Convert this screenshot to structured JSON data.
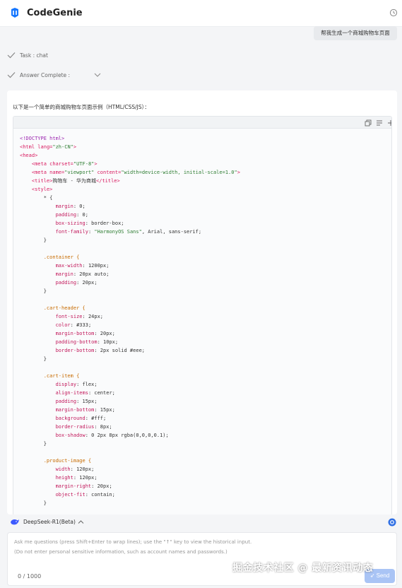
{
  "header": {
    "app_title": "CodeGenie",
    "logo_icon": "codegenie-logo-icon",
    "history_icon": "history-clock-icon"
  },
  "user_message": "帮我生成一个商城购物车页面",
  "steps": [
    {
      "label": "Task :  chat"
    },
    {
      "label": "Answer Complete :"
    }
  ],
  "answer": {
    "intro": "以下是一个简单的商城购物车页面示例（HTML/CSS/JS）：",
    "code_toolbar": {
      "copy_icon": "copy-icon",
      "insert_icon": "insert-lines-icon",
      "add_icon": "plus-icon"
    },
    "code_lines": [
      [
        {
          "t": "<!DOCTYPE html>",
          "c": "#9c27b0"
        }
      ],
      [
        {
          "t": "<html ",
          "c": "#d81b60"
        },
        {
          "t": "lang=",
          "c": "#d81b60"
        },
        {
          "t": "\"zh-CN\"",
          "c": "#2e7d32"
        },
        {
          "t": ">",
          "c": "#d81b60"
        }
      ],
      [
        {
          "t": "<head>",
          "c": "#d81b60"
        }
      ],
      [
        {
          "t": "    <meta ",
          "c": "#d81b60"
        },
        {
          "t": "charset=",
          "c": "#d81b60"
        },
        {
          "t": "\"UTF-8\"",
          "c": "#2e7d32"
        },
        {
          "t": ">",
          "c": "#d81b60"
        }
      ],
      [
        {
          "t": "    <meta ",
          "c": "#d81b60"
        },
        {
          "t": "name=",
          "c": "#d81b60"
        },
        {
          "t": "\"viewport\" ",
          "c": "#2e7d32"
        },
        {
          "t": "content=",
          "c": "#d81b60"
        },
        {
          "t": "\"width=device-width, initial-scale=1.0\"",
          "c": "#2e7d32"
        },
        {
          "t": ">",
          "c": "#d81b60"
        }
      ],
      [
        {
          "t": "    <title>",
          "c": "#d81b60"
        },
        {
          "t": "购物车 - 华为商城",
          "c": "#333333"
        },
        {
          "t": "</title>",
          "c": "#d81b60"
        }
      ],
      [
        {
          "t": "    <style>",
          "c": "#d81b60"
        }
      ],
      [
        {
          "t": "        * {",
          "c": "#333333"
        }
      ],
      [
        {
          "t": "            margin",
          "c": "#c2185b"
        },
        {
          "t": ": 0;",
          "c": "#333333"
        }
      ],
      [
        {
          "t": "            padding",
          "c": "#c2185b"
        },
        {
          "t": ": 0;",
          "c": "#333333"
        }
      ],
      [
        {
          "t": "            box-sizing",
          "c": "#c2185b"
        },
        {
          "t": ": border-box;",
          "c": "#333333"
        }
      ],
      [
        {
          "t": "            font-family",
          "c": "#c2185b"
        },
        {
          "t": ": ",
          "c": "#333333"
        },
        {
          "t": "\"HarmonyOS Sans\"",
          "c": "#2e7d32"
        },
        {
          "t": ", Arial, sans-serif;",
          "c": "#333333"
        }
      ],
      [
        {
          "t": "        }",
          "c": "#333333"
        }
      ],
      [
        {
          "t": "",
          "c": "#333333"
        }
      ],
      [
        {
          "t": "        .container {",
          "c": "#c76b00"
        }
      ],
      [
        {
          "t": "            max-width",
          "c": "#c2185b"
        },
        {
          "t": ": 1200px;",
          "c": "#333333"
        }
      ],
      [
        {
          "t": "            margin",
          "c": "#c2185b"
        },
        {
          "t": ": 20px auto;",
          "c": "#333333"
        }
      ],
      [
        {
          "t": "            padding",
          "c": "#c2185b"
        },
        {
          "t": ": 20px;",
          "c": "#333333"
        }
      ],
      [
        {
          "t": "        }",
          "c": "#333333"
        }
      ],
      [
        {
          "t": "",
          "c": "#333333"
        }
      ],
      [
        {
          "t": "        .cart-header {",
          "c": "#c76b00"
        }
      ],
      [
        {
          "t": "            font-size",
          "c": "#c2185b"
        },
        {
          "t": ": 24px;",
          "c": "#333333"
        }
      ],
      [
        {
          "t": "            color",
          "c": "#c2185b"
        },
        {
          "t": ": #333;",
          "c": "#333333"
        }
      ],
      [
        {
          "t": "            margin-bottom",
          "c": "#c2185b"
        },
        {
          "t": ": 20px;",
          "c": "#333333"
        }
      ],
      [
        {
          "t": "            padding-bottom",
          "c": "#c2185b"
        },
        {
          "t": ": 10px;",
          "c": "#333333"
        }
      ],
      [
        {
          "t": "            border-bottom",
          "c": "#c2185b"
        },
        {
          "t": ": 2px solid #eee;",
          "c": "#333333"
        }
      ],
      [
        {
          "t": "        }",
          "c": "#333333"
        }
      ],
      [
        {
          "t": "",
          "c": "#333333"
        }
      ],
      [
        {
          "t": "        .cart-item {",
          "c": "#c76b00"
        }
      ],
      [
        {
          "t": "            display",
          "c": "#c2185b"
        },
        {
          "t": ": flex;",
          "c": "#333333"
        }
      ],
      [
        {
          "t": "            align-items",
          "c": "#c2185b"
        },
        {
          "t": ": center;",
          "c": "#333333"
        }
      ],
      [
        {
          "t": "            padding",
          "c": "#c2185b"
        },
        {
          "t": ": 15px;",
          "c": "#333333"
        }
      ],
      [
        {
          "t": "            margin-bottom",
          "c": "#c2185b"
        },
        {
          "t": ": 15px;",
          "c": "#333333"
        }
      ],
      [
        {
          "t": "            background",
          "c": "#c2185b"
        },
        {
          "t": ": #fff;",
          "c": "#333333"
        }
      ],
      [
        {
          "t": "            border-radius",
          "c": "#c2185b"
        },
        {
          "t": ": 8px;",
          "c": "#333333"
        }
      ],
      [
        {
          "t": "            box-shadow",
          "c": "#c2185b"
        },
        {
          "t": ": 0 2px 8px rgba(0,0,0,0.1);",
          "c": "#333333"
        }
      ],
      [
        {
          "t": "        }",
          "c": "#333333"
        }
      ],
      [
        {
          "t": "",
          "c": "#333333"
        }
      ],
      [
        {
          "t": "        .product-image {",
          "c": "#c76b00"
        }
      ],
      [
        {
          "t": "            width",
          "c": "#c2185b"
        },
        {
          "t": ": 120px;",
          "c": "#333333"
        }
      ],
      [
        {
          "t": "            height",
          "c": "#c2185b"
        },
        {
          "t": ": 120px;",
          "c": "#333333"
        }
      ],
      [
        {
          "t": "            margin-right",
          "c": "#c2185b"
        },
        {
          "t": ": 20px;",
          "c": "#333333"
        }
      ],
      [
        {
          "t": "            object-fit",
          "c": "#c2185b"
        },
        {
          "t": ": contain;",
          "c": "#333333"
        }
      ],
      [
        {
          "t": "        }",
          "c": "#333333"
        }
      ]
    ]
  },
  "model_selector": {
    "label": "DeepSeek-R1(Beta)",
    "icon": "deepseek-whale-icon",
    "assist_icon": "assistant-orb-icon"
  },
  "input": {
    "placeholder_line1": "Ask me questions (press Shift+Enter to wrap lines); use the \"↑\" key to view the historical input.",
    "placeholder_line2": "(Do not enter personal sensitive information, such as account names and passwords.)",
    "counter": "0 / 1000",
    "send_label": "Send"
  },
  "watermark": "掘金技术社区 @ 最新资讯动态",
  "colors": {
    "accent": "#1677ff",
    "send_disabled": "#a9c4f5",
    "keyword": "#d81b60",
    "string": "#2e7d32",
    "selector": "#c76b00"
  }
}
